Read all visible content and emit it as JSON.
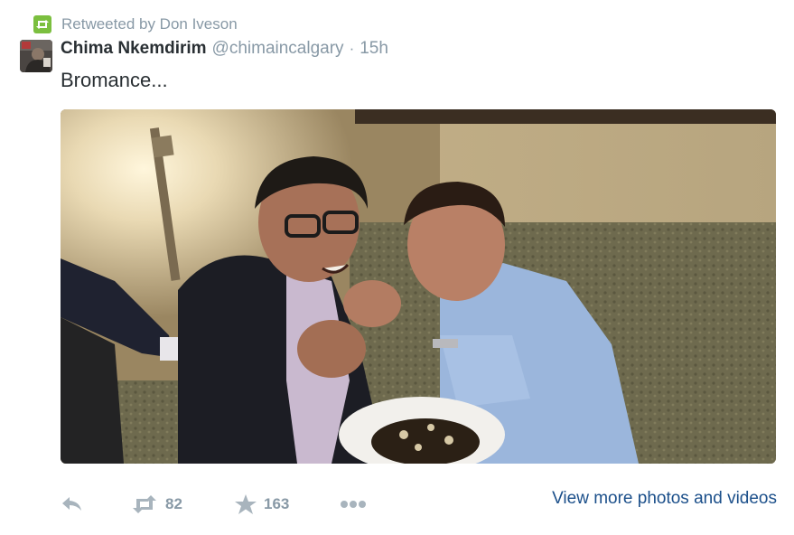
{
  "retweet_context": {
    "text": "Retweeted by Don Iveson",
    "icon": "retweet-icon",
    "badge_color": "#7bbf3f"
  },
  "author": {
    "fullname": "Chima Nkemdirim",
    "username": "@chimaincalgary",
    "separator": "·",
    "timestamp": "15h"
  },
  "tweet": {
    "text": "Bromance..."
  },
  "media": {
    "type": "photo",
    "description_icon": "photo"
  },
  "actions": {
    "reply": {
      "icon": "reply-icon"
    },
    "retweet": {
      "icon": "retweet-icon",
      "count": "82"
    },
    "favorite": {
      "icon": "star-icon",
      "count": "163"
    },
    "more": {
      "icon": "more-icon"
    },
    "view_more_label": "View more photos and videos"
  },
  "colors": {
    "muted": "#8899a6",
    "text": "#292f33",
    "link": "#1b4f8a"
  }
}
